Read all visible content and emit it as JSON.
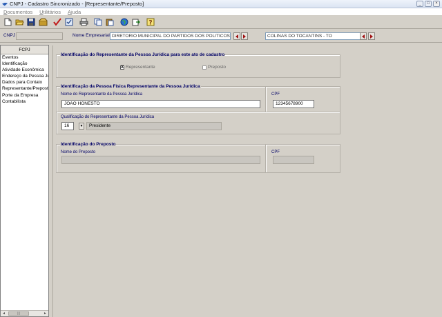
{
  "window": {
    "title": "CNPJ - Cadastro Sincronizado - [Representante/Preposto]",
    "controls": [
      "_",
      "□",
      "×"
    ]
  },
  "menu": {
    "items": [
      "Documentos",
      "Utilitários",
      "Ajuda"
    ]
  },
  "toolbar": {
    "icons": [
      "new-file-icon",
      "open-folder-icon",
      "save-icon",
      "open-package-icon",
      "check-icon",
      "verify-icon",
      "print-icon",
      "copy-icon",
      "paste-icon",
      "web-icon",
      "export-icon",
      "help-icon"
    ]
  },
  "header": {
    "cnpj_label": "CNPJ",
    "cnpj_value": "",
    "nome_label": "Nome Empresarial",
    "nome_value": "DIRETORIO MUNICIPAL DO PARTIDOS DOS POLITICOS HO",
    "municipio_value": "COLINAS DO TOCANTINS - TO"
  },
  "sidebar": {
    "title": "FCPJ",
    "items": [
      "Eventos",
      "Identificação",
      "Atividade Econômica",
      "Endereço da Pessoa Jurí",
      "Dados para Contato",
      "Representante/Preposto",
      "Porte da Empresa",
      "Contabilista"
    ],
    "scroll_left": "◄",
    "scroll_right": "►",
    "scroll_grip": "|||"
  },
  "section1": {
    "title": "Identificação do Representante da Pessoa Jurídica para este ato de cadastro",
    "option_representante": "Representante",
    "option_representante_checked": "X",
    "option_preposto": "Preposto"
  },
  "section2": {
    "title": "Identificação da Pessoa Física Representante da Pessoa Jurídica",
    "nome_label": "Nome do Representante da Pessoa Jurídica",
    "nome_value": "JOAO HONESTO",
    "cpf_label": "CPF",
    "cpf_value": "12345678900",
    "qualificacao_label": "Qualificação do Representante da Pessoa Jurídica",
    "qualificacao_code": "16",
    "qualificacao_desc": "Presidente"
  },
  "section3": {
    "title": "Identificação do Preposto",
    "nome_label": "Nome do Preposto",
    "nome_value": "",
    "cpf_label": "CPF",
    "cpf_value": ""
  }
}
